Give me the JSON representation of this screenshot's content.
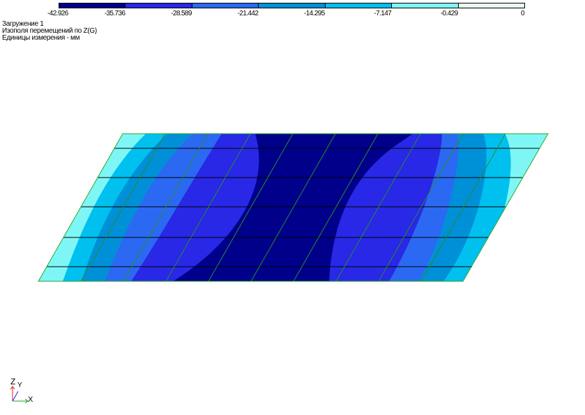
{
  "legend": {
    "colors": [
      "#00008b",
      "#2828e6",
      "#2b69f2",
      "#0090d8",
      "#00c0ef",
      "#7ff6f6",
      "#eafcef"
    ],
    "labels": [
      "-42.926",
      "-35.736",
      "-28.589",
      "-21.442",
      "-14.295",
      "-7.147",
      "-0.429",
      "0"
    ]
  },
  "info": {
    "load_case": "Загружение  1",
    "isofield": "Изополя  перемещений по Z(G)",
    "units": "Единицы измерения - мм"
  },
  "axes": {
    "z_label": "Z",
    "y_label": "Y",
    "x_label": "X"
  },
  "plate": {
    "grid_color": "#000000",
    "edge_color": "#28a828",
    "diagonal_color": "#2a8a2a"
  }
}
